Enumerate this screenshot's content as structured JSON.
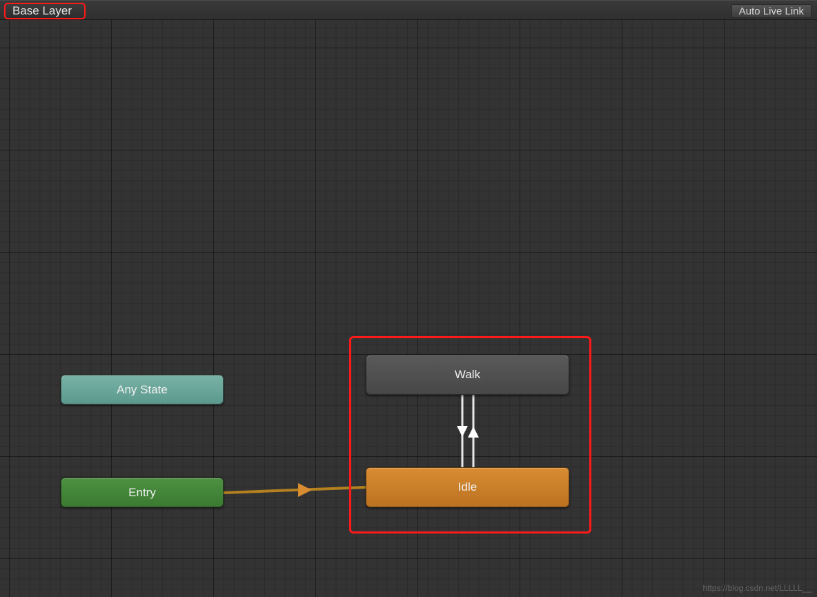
{
  "header": {
    "breadcrumb": "Base Layer",
    "autoLiveLink": "Auto Live Link"
  },
  "nodes": {
    "anyState": "Any State",
    "entry": "Entry",
    "walk": "Walk",
    "idle": "Idle"
  },
  "transitions": [
    {
      "from": "Entry",
      "to": "Idle"
    },
    {
      "from": "Walk",
      "to": "Idle"
    },
    {
      "from": "Idle",
      "to": "Walk"
    }
  ],
  "highlights": {
    "breadcrumb": true,
    "statesGroup": [
      "Walk",
      "Idle"
    ]
  },
  "watermark": "https://blog.csdn.net/LLLLL__"
}
